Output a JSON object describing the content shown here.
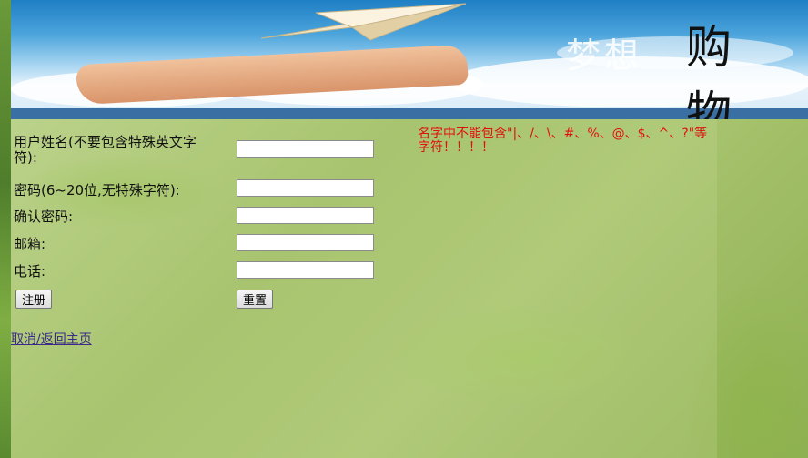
{
  "banner": {
    "title_light": "梦想",
    "title_dark": "购物"
  },
  "form": {
    "username_label": "用户姓名(不要包含特殊英文字符):",
    "password_label": "密码(6~20位,无特殊字符):",
    "confirm_label": "确认密码:",
    "email_label": "邮箱:",
    "phone_label": "电话:",
    "username_value": "",
    "password_value": "",
    "confirm_value": "",
    "email_value": "",
    "phone_value": "",
    "register_label": "注册",
    "reset_label": "重置"
  },
  "warning": "名字中不能包含\"|、/、\\、#、%、@、$、^、?\"等字符！！！！",
  "back_link": "取消/返回主页"
}
